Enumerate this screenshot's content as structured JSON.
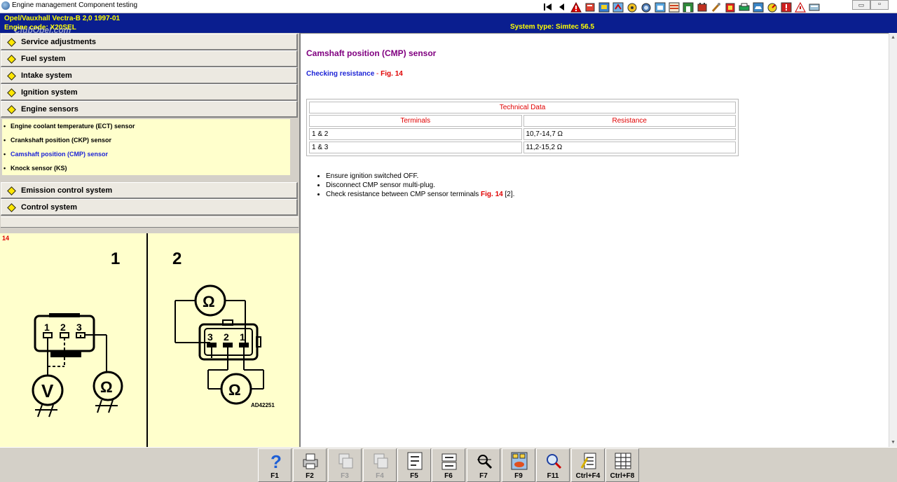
{
  "window": {
    "title": "Engine management Component testing",
    "controls": [
      "minimize",
      "maximize",
      "close"
    ]
  },
  "toolbar_icons": [
    "first-record-icon",
    "previous-record-icon",
    "warning-triangle-icon",
    "repair-book-icon",
    "fuse-icon",
    "electrical-icon",
    "wheel-icon",
    "tyre-icon",
    "engine-icon",
    "wiring-icon",
    "garage-icon",
    "battery-icon",
    "tools-icon",
    "clipboard-icon",
    "print-icon",
    "car-icon",
    "gauge-icon",
    "alert-icon",
    "message-icon",
    "info-icon"
  ],
  "header": {
    "vehicle": "Opel/Vauxhall   Vectra-B  2,0  1997-01",
    "engine": "Engine code: X20SEL",
    "system": "System type: Simtec 56.5",
    "watermark": "ClubOpel.com"
  },
  "sidebar": {
    "groups": [
      {
        "label": "Service adjustments"
      },
      {
        "label": "Fuel system"
      },
      {
        "label": "Intake system"
      },
      {
        "label": "Ignition system"
      },
      {
        "label": "Engine sensors"
      },
      {
        "label": "Emission control system"
      },
      {
        "label": "Control system"
      }
    ],
    "subitems": [
      {
        "label": "Engine coolant temperature (ECT) sensor"
      },
      {
        "label": "Crankshaft position (CKP) sensor"
      },
      {
        "label": "Camshaft position (CMP) sensor"
      },
      {
        "label": "Knock sensor (KS)"
      }
    ],
    "active_subitem": "Camshaft position (CMP) sensor"
  },
  "figure": {
    "number": "14",
    "panel1": "1",
    "panel2": "2",
    "pins_left": [
      "1",
      "2",
      "3"
    ],
    "pins_right": [
      "3",
      "2",
      "1"
    ],
    "meter_volt": "V",
    "meter_ohm": "Ω",
    "code": "AD42251"
  },
  "content": {
    "title": "Camshaft position (CMP) sensor",
    "check_label": "Checking resistance",
    "check_sep": " - ",
    "check_fig": "Fig. 14",
    "table": {
      "caption": "Technical Data",
      "headers": [
        "Terminals",
        "Resistance"
      ],
      "rows": [
        [
          "1 & 2",
          "10,7-14,7 Ω"
        ],
        [
          "1 & 3",
          "11,2-15,2 Ω"
        ]
      ]
    },
    "steps": [
      {
        "text": "Ensure ignition switched OFF."
      },
      {
        "text": "Disconnect CMP sensor multi-plug."
      },
      {
        "text": "Check resistance between CMP sensor terminals ",
        "fig": "Fig. 14",
        "suffix": " [2]."
      }
    ]
  },
  "function_keys": [
    {
      "label": "F1",
      "icon": "help-icon",
      "enabled": true
    },
    {
      "label": "F2",
      "icon": "print-icon",
      "enabled": true
    },
    {
      "label": "F3",
      "icon": "copy-icon",
      "enabled": false
    },
    {
      "label": "F4",
      "icon": "paste-icon",
      "enabled": false
    },
    {
      "label": "F5",
      "icon": "diagram-icon",
      "enabled": true
    },
    {
      "label": "F6",
      "icon": "connector-icon",
      "enabled": true
    },
    {
      "label": "F7",
      "icon": "zoom-tool-icon",
      "enabled": true
    },
    {
      "label": "F9",
      "icon": "component-icon",
      "enabled": true
    },
    {
      "label": "F11",
      "icon": "search-icon",
      "enabled": true
    },
    {
      "label": "Ctrl+F4",
      "icon": "notes-icon",
      "enabled": true
    },
    {
      "label": "Ctrl+F8",
      "icon": "table-icon",
      "enabled": true
    }
  ],
  "colors": {
    "header_bg": "#0a1e8f",
    "header_text": "#ffff00",
    "title_purple": "#800080",
    "link_blue": "#1d24d6",
    "accent_red": "#e00000",
    "figure_bg": "#ffffcc"
  }
}
